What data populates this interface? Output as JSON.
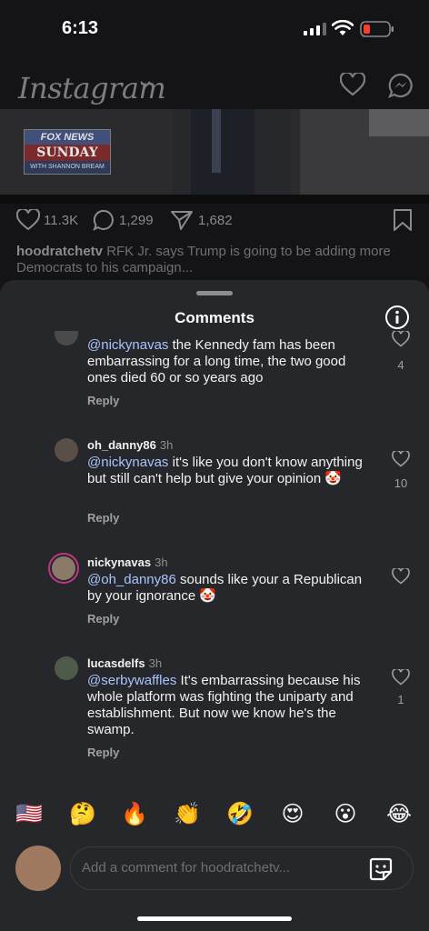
{
  "status": {
    "time": "6:13"
  },
  "feed": {
    "app_name": "Instagram",
    "video_banner": {
      "top": "FOX NEWS",
      "middle": "SUNDAY",
      "bottom": "WITH SHANNON BREAM"
    },
    "likes": "11.3K",
    "comments": "1,299",
    "shares": "1,682",
    "caption_user": "hoodratchetv",
    "caption_text": "RFK Jr. says Trump is going to be adding more Democrats to his campaign..."
  },
  "sheet": {
    "title": "Comments",
    "comments": [
      {
        "user": "",
        "time": "",
        "mention": "@nickynavas",
        "text": " the Kennedy fam has been embarrassing for a long time, the two good ones died 60 or so years ago",
        "reply": "Reply",
        "likes": "4"
      },
      {
        "user": "oh_danny86",
        "time": "3h",
        "mention": "@nickynavas",
        "text": " it's like you don't know anything but still can't help but give your opinion 🤡",
        "reply": "Reply",
        "likes": "10"
      },
      {
        "user": "nickynavas",
        "time": "3h",
        "mention": "@oh_danny86",
        "text": " sounds like your a Republican by your ignorance 🤡",
        "reply": "Reply",
        "likes": ""
      },
      {
        "user": "lucasdelfs",
        "time": "3h",
        "mention": "@serbywaffles",
        "text": " It's embarrassing because his whole platform was fighting the uniparty and establishment.  But now we know he's the swamp.",
        "reply": "Reply",
        "likes": "1"
      }
    ],
    "emojis": [
      "🇺🇸",
      "🤔",
      "🔥",
      "👏",
      "🤣",
      "😍",
      "😮",
      "😂"
    ],
    "input_placeholder": "Add a comment for hoodratchetv..."
  }
}
